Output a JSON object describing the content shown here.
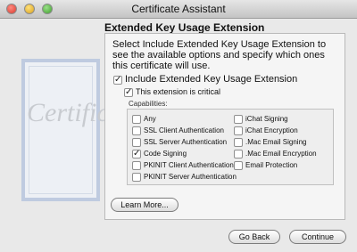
{
  "window": {
    "title": "Certificate Assistant"
  },
  "decor": {
    "certificate_text": "Certific"
  },
  "section": {
    "title": "Extended Key Usage Extension",
    "description": "Select Include Extended Key Usage Extension to see the available options and specify which ones this certificate will use.",
    "include_label": "Include Extended Key Usage Extension",
    "include_checked": true,
    "critical_label": "This extension is critical",
    "critical_checked": true,
    "capabilities_label": "Capabilities:"
  },
  "capabilities": {
    "left": [
      {
        "label": "Any",
        "checked": false
      },
      {
        "label": "SSL Client Authentication",
        "checked": false
      },
      {
        "label": "SSL Server Authentication",
        "checked": false
      },
      {
        "label": "Code Signing",
        "checked": true
      },
      {
        "label": "PKINIT Client Authentication",
        "checked": false
      },
      {
        "label": "PKINIT Server Authentication",
        "checked": false
      }
    ],
    "right": [
      {
        "label": "iChat Signing",
        "checked": false
      },
      {
        "label": "iChat Encryption",
        "checked": false
      },
      {
        "label": ".Mac Email Signing",
        "checked": false
      },
      {
        "label": ".Mac Email Encryption",
        "checked": false
      },
      {
        "label": "Email Protection",
        "checked": false
      }
    ]
  },
  "buttons": {
    "learn_more": "Learn More...",
    "go_back": "Go Back",
    "continue": "Continue"
  }
}
